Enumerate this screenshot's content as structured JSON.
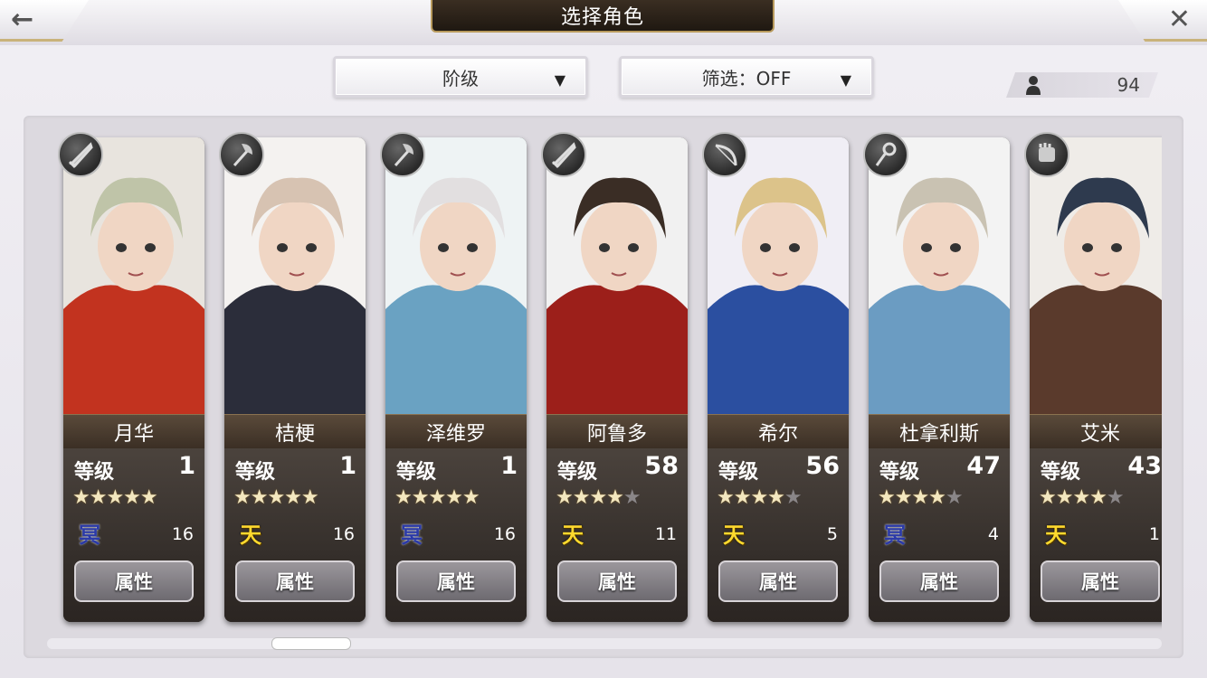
{
  "header": {
    "title": "选择角色",
    "back_icon": "←",
    "close_icon": "✕"
  },
  "filters": {
    "sort_label": "阶级",
    "filter_label": "筛选：OFF",
    "arrow": "▼"
  },
  "owned_count": "94",
  "colors": {
    "sky_element": "#ffd92e",
    "dark_element": "#2b3aa8",
    "star_on": "#f3e7bf",
    "star_off": "#8a8688"
  },
  "common": {
    "level_label": "等级",
    "attr_button": "属性"
  },
  "characters": [
    {
      "name": "月华",
      "level": "1",
      "stars": 5,
      "stars_text": "★★★★★",
      "stars_off": "",
      "element": "冥",
      "element_type": "dark",
      "cost": "16",
      "weapon_icon": "sword-icon",
      "palette": [
        "#e8e4de",
        "#c2331f",
        "#bfc4a8"
      ]
    },
    {
      "name": "桔梗",
      "level": "1",
      "stars": 5,
      "stars_text": "★★★★★",
      "stars_off": "",
      "element": "天",
      "element_type": "sky",
      "cost": "16",
      "weapon_icon": "axe-icon",
      "palette": [
        "#f4f2f0",
        "#2b2d3a",
        "#d7c3b2"
      ]
    },
    {
      "name": "泽维罗",
      "level": "1",
      "stars": 5,
      "stars_text": "★★★★★",
      "stars_off": "",
      "element": "冥",
      "element_type": "dark",
      "cost": "16",
      "weapon_icon": "axe-icon",
      "palette": [
        "#eef3f4",
        "#6aa2c2",
        "#e2dfe0"
      ]
    },
    {
      "name": "阿鲁多",
      "level": "58",
      "stars": 4,
      "stars_text": "★★★★",
      "stars_off": "★",
      "element": "天",
      "element_type": "sky",
      "cost": "11",
      "weapon_icon": "sword-icon",
      "palette": [
        "#f1f1f1",
        "#9c1f1a",
        "#3a2d25"
      ]
    },
    {
      "name": "希尔",
      "level": "56",
      "stars": 4,
      "stars_text": "★★★★",
      "stars_off": "★",
      "element": "天",
      "element_type": "sky",
      "cost": "5",
      "weapon_icon": "bow-icon",
      "palette": [
        "#f0eef5",
        "#2b4fa0",
        "#dcc38a"
      ]
    },
    {
      "name": "杜拿利斯",
      "level": "47",
      "stars": 4,
      "stars_text": "★★★★",
      "stars_off": "★",
      "element": "冥",
      "element_type": "dark",
      "cost": "4",
      "weapon_icon": "staff-icon",
      "palette": [
        "#f3f3f3",
        "#6b9cc2",
        "#c9c2b2"
      ]
    },
    {
      "name": "艾米",
      "level": "43",
      "stars": 4,
      "stars_text": "★★★★",
      "stars_off": "★",
      "element": "天",
      "element_type": "sky",
      "cost": "1",
      "weapon_icon": "gauntlet-icon",
      "palette": [
        "#efece8",
        "#5a3a2c",
        "#2e3a4e"
      ]
    }
  ]
}
